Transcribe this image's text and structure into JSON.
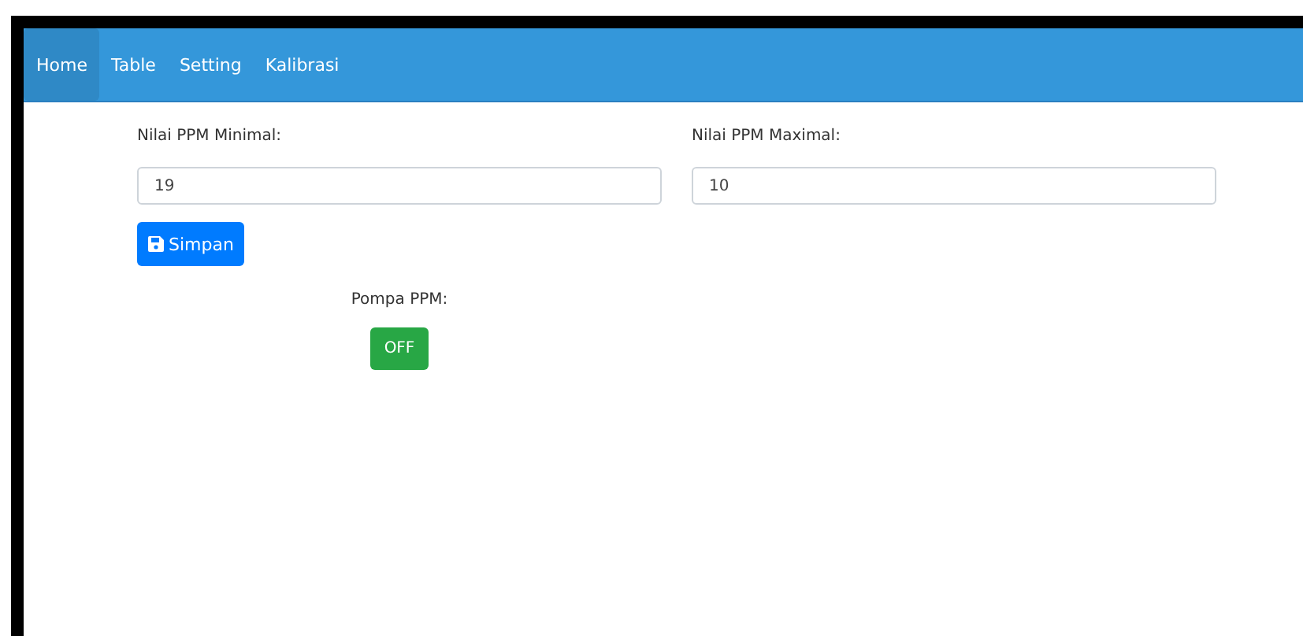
{
  "navbar": {
    "items": [
      {
        "label": "Home",
        "selected": true
      },
      {
        "label": "Table",
        "selected": false
      },
      {
        "label": "Setting",
        "selected": false
      },
      {
        "label": "Kalibrasi",
        "selected": false
      }
    ]
  },
  "form": {
    "fields": [
      {
        "label": "Nilai PPM Minimal:",
        "value": "19"
      },
      {
        "label": "Nilai PPM Maximal:",
        "value": "10"
      }
    ],
    "save_button": "Simpan"
  },
  "pump": {
    "label": "Pompa PPM:",
    "button": "OFF"
  }
}
